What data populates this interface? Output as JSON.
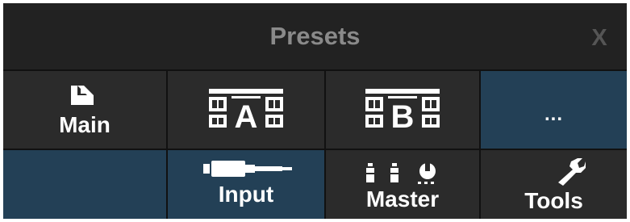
{
  "window": {
    "title": "Presets",
    "close_label": "X"
  },
  "buttons": {
    "main": {
      "label": "Main",
      "icon": "document-icon"
    },
    "preset_a": {
      "glyph": "A",
      "icon": "bank-a-icon"
    },
    "preset_b": {
      "glyph": "B",
      "icon": "bank-b-icon"
    },
    "more": {
      "label": "..."
    },
    "input": {
      "label": "Input",
      "icon": "input-plug-icon"
    },
    "master": {
      "label": "Master",
      "icon": "master-controls-icon"
    },
    "tools": {
      "label": "Tools",
      "icon": "wrench-icon"
    }
  },
  "colors": {
    "header_bg": "#222222",
    "button_bg": "#2b2b2b",
    "button_selected_bg": "#234056",
    "title_text": "#8a8a8a"
  }
}
